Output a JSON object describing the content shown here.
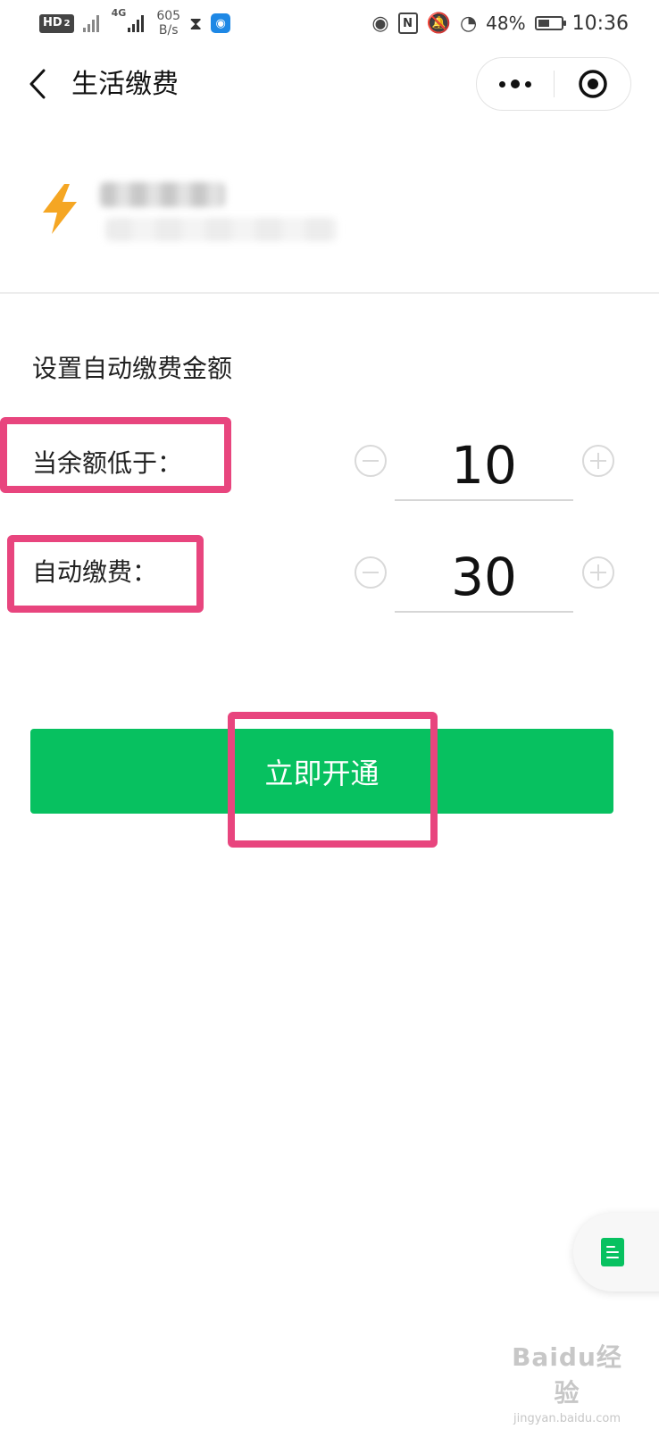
{
  "status_bar": {
    "hd_label": "HD",
    "sim_label": "2",
    "network_type": "4G",
    "speed_value": "605",
    "speed_unit": "B/s",
    "battery_percent": "48%",
    "battery_level": 0.48,
    "time": "10:36",
    "icons": [
      "signal-x-icon",
      "signal-4g-icon",
      "hourglass-icon",
      "wifi-app-icon",
      "eye-icon",
      "nfc-icon",
      "mute-bell-icon",
      "speed-gauge-icon",
      "battery-icon"
    ]
  },
  "nav": {
    "title": "生活缴费"
  },
  "form": {
    "heading": "设置自动缴费金额",
    "threshold_label": "当余额低于：",
    "threshold_value": "10",
    "auto_pay_label": "自动缴费：",
    "auto_pay_value": "30"
  },
  "actions": {
    "submit_label": "立即开通"
  },
  "watermark": {
    "main": "Baidu经验",
    "sub": "jingyan.baidu.com"
  },
  "colors": {
    "primary_green": "#07c160",
    "highlight_pink": "#e8457e",
    "lightning_orange": "#f5a623"
  }
}
